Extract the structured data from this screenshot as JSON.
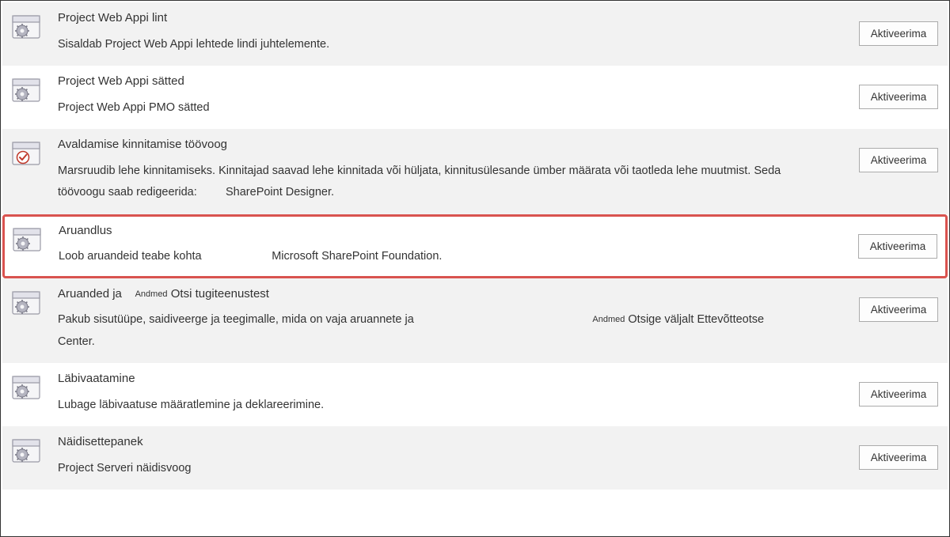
{
  "button_label": "Aktiveerima",
  "features": [
    {
      "title": "Project Web Appi lint",
      "desc": "Sisaldab Project Web Appi lehtede lindi juhtelemente.",
      "icon": "gear",
      "alt": true,
      "highlighted": false
    },
    {
      "title": "Project Web Appi sätted",
      "desc": "Project Web Appi PMO sätted",
      "icon": "gear",
      "alt": false,
      "highlighted": false
    },
    {
      "title": "Avaldamise kinnitamise töövoog",
      "desc": "Marsruudib lehe kinnitamiseks. Kinnitajad saavad lehe kinnitada või hüljata, kinnitusülesande ümber määrata või taotleda lehe muutmist. Seda töövoogu saab redigeerida:         SharePoint Designer.",
      "icon": "check",
      "alt": true,
      "highlighted": false
    },
    {
      "title": "Aruandlus",
      "desc": "Loob aruandeid teabe kohta                      Microsoft SharePoint Foundation.",
      "icon": "gear",
      "alt": false,
      "highlighted": true
    },
    {
      "title_html": "Aruanded ja    <span class=\"small-super\">Andmed</span> Otsi tugiteenustest",
      "desc_html": "Pakub sisutüüpe, saidiveerge ja teegimalle, mida on vaja aruannete ja                                                        <span class=\"small-super\">Andmed</span> Otsige väljalt Ettevõtteotse            Center.",
      "icon": "gear",
      "alt": true,
      "highlighted": false
    },
    {
      "title": "Läbivaatamine",
      "desc": "Lubage läbivaatuse määratlemine ja deklareerimine.",
      "icon": "gear",
      "alt": false,
      "highlighted": false
    },
    {
      "title": "Näidisettepanek",
      "desc": "Project Serveri näidisvoog",
      "icon": "gear",
      "alt": true,
      "highlighted": false
    }
  ]
}
